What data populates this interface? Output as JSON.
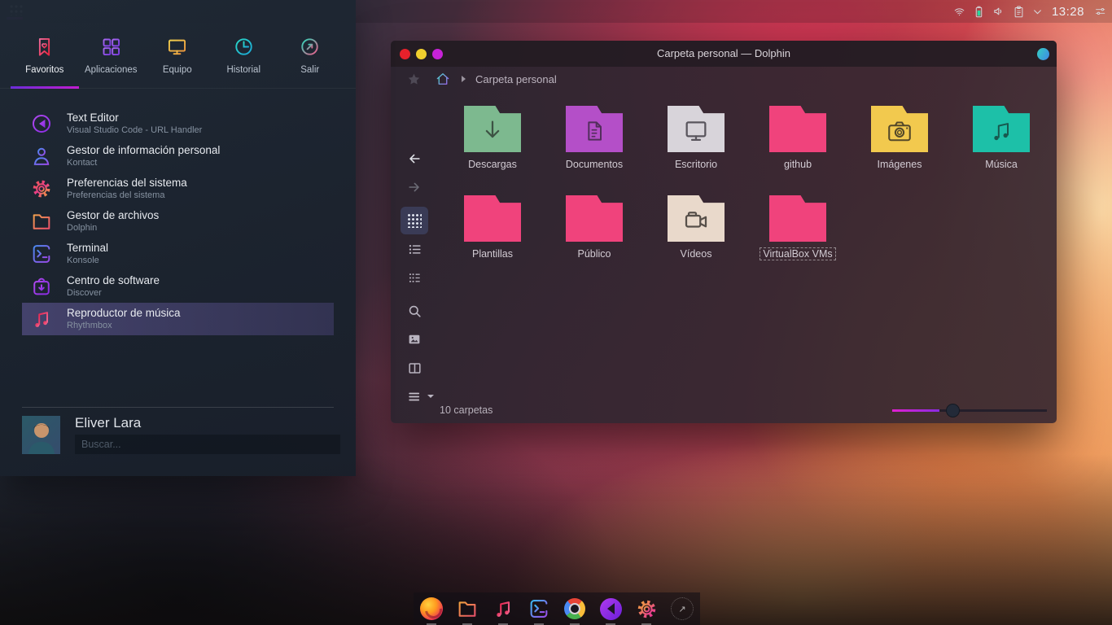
{
  "topbar": {
    "clock": "13:28",
    "tray_icons": [
      "network-wifi",
      "battery",
      "volume",
      "clipboard",
      "chevron-down",
      "tune-settings"
    ]
  },
  "launcher": {
    "active_tab": "Favoritos",
    "tabs": [
      {
        "label": "Favoritos",
        "icon": "bookmark-heart"
      },
      {
        "label": "Aplicaciones",
        "icon": "app-grid"
      },
      {
        "label": "Equipo",
        "icon": "monitor"
      },
      {
        "label": "Historial",
        "icon": "clock"
      },
      {
        "label": "Salir",
        "icon": "logout-arrow"
      }
    ],
    "items": [
      {
        "title": "Text Editor",
        "subtitle": "Visual Studio Code - URL Handler",
        "icon": "vscode"
      },
      {
        "title": "Gestor de información personal",
        "subtitle": "Kontact",
        "icon": "person"
      },
      {
        "title": "Preferencias del sistema",
        "subtitle": "Preferencias del sistema",
        "icon": "gear"
      },
      {
        "title": "Gestor de archivos",
        "subtitle": "Dolphin",
        "icon": "folder"
      },
      {
        "title": "Terminal",
        "subtitle": "Konsole",
        "icon": "terminal"
      },
      {
        "title": "Centro de software",
        "subtitle": "Discover",
        "icon": "bag-download"
      },
      {
        "title": "Reproductor de música",
        "subtitle": "Rhythmbox",
        "icon": "music-notes",
        "selected": true
      }
    ],
    "user": {
      "name": "Eliver Lara",
      "search_placeholder": "Buscar..."
    }
  },
  "dolphin": {
    "title": "Carpeta personal — Dolphin",
    "breadcrumb_location": "Carpeta personal",
    "titlebar_button_colors": [
      "#e8212b",
      "#f0cf2e",
      "#c722d8"
    ],
    "accent_button_color": "#3bc0d8",
    "sidebar_tools": [
      "back",
      "forward",
      "grid-view",
      "list-view",
      "compact-view",
      "search",
      "preview",
      "split-view",
      "menu"
    ],
    "active_view": "grid-view",
    "folders": [
      {
        "name": "Descargas",
        "color": "#7db98f",
        "glyph": "download-arrow"
      },
      {
        "name": "Documentos",
        "color": "#b44fc8",
        "glyph": "document"
      },
      {
        "name": "Escritorio",
        "color": "#d8d4da",
        "glyph": "monitor"
      },
      {
        "name": "github",
        "color": "#f0437c",
        "glyph": "none"
      },
      {
        "name": "Imágenes",
        "color": "#f2c94e",
        "glyph": "camera"
      },
      {
        "name": "Música",
        "color": "#1dc0a8",
        "glyph": "music-note"
      },
      {
        "name": "Plantillas",
        "color": "#f0437c",
        "glyph": "none"
      },
      {
        "name": "Público",
        "color": "#f0437c",
        "glyph": "none"
      },
      {
        "name": "Vídeos",
        "color": "#e9d9cb",
        "glyph": "video-camera"
      },
      {
        "name": "VirtualBox VMs",
        "color": "#f0437c",
        "glyph": "none",
        "selected": true
      }
    ],
    "status_text": "10 carpetas",
    "zoom_slider_fraction": 0.3
  },
  "dock": {
    "icons": [
      "firefox",
      "file-manager",
      "music-player",
      "terminal",
      "chrome",
      "vscode",
      "settings",
      "session"
    ]
  },
  "colors": {
    "selection_highlight": "#675c9e",
    "panel_bg": "#1e2732",
    "window_bg": "#2e2531",
    "slider_accent": "#c21ad0"
  }
}
